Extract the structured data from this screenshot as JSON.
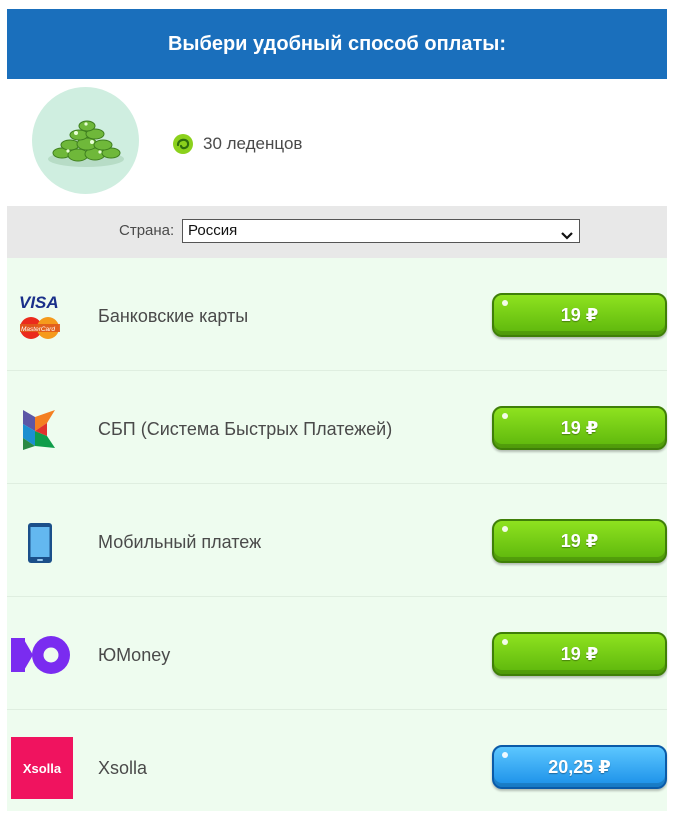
{
  "header": {
    "title": "Выбери удобный способ оплаты:"
  },
  "product": {
    "label": "30 леденцов",
    "image_icon": "candies-pile-icon",
    "currency_icon": "candy-icon"
  },
  "country": {
    "label": "Страна:",
    "selected": "Россия"
  },
  "methods": [
    {
      "name": "Банковские карты",
      "price": "19 ₽",
      "icon": "visa-mastercard-icon",
      "style": "green"
    },
    {
      "name": "СБП (Система Быстрых Платежей)",
      "price": "19 ₽",
      "icon": "sbp-icon",
      "style": "green"
    },
    {
      "name": "Мобильный платеж",
      "price": "19 ₽",
      "icon": "mobile-phone-icon",
      "style": "green"
    },
    {
      "name": "ЮMoney",
      "price": "19 ₽",
      "icon": "yoomoney-icon",
      "style": "green"
    },
    {
      "name": "Xsolla",
      "price": "20,25 ₽",
      "icon": "xsolla-icon",
      "style": "blue",
      "logo_text": "Xsolla"
    }
  ],
  "visa_logo": {
    "visa_text": "VISA",
    "mastercard_text": "MasterCard"
  },
  "colors": {
    "header": "#1a6fbc",
    "green_button": "#6cc513",
    "blue_button": "#2a9ff0",
    "rows_bg": "#eefcef"
  }
}
